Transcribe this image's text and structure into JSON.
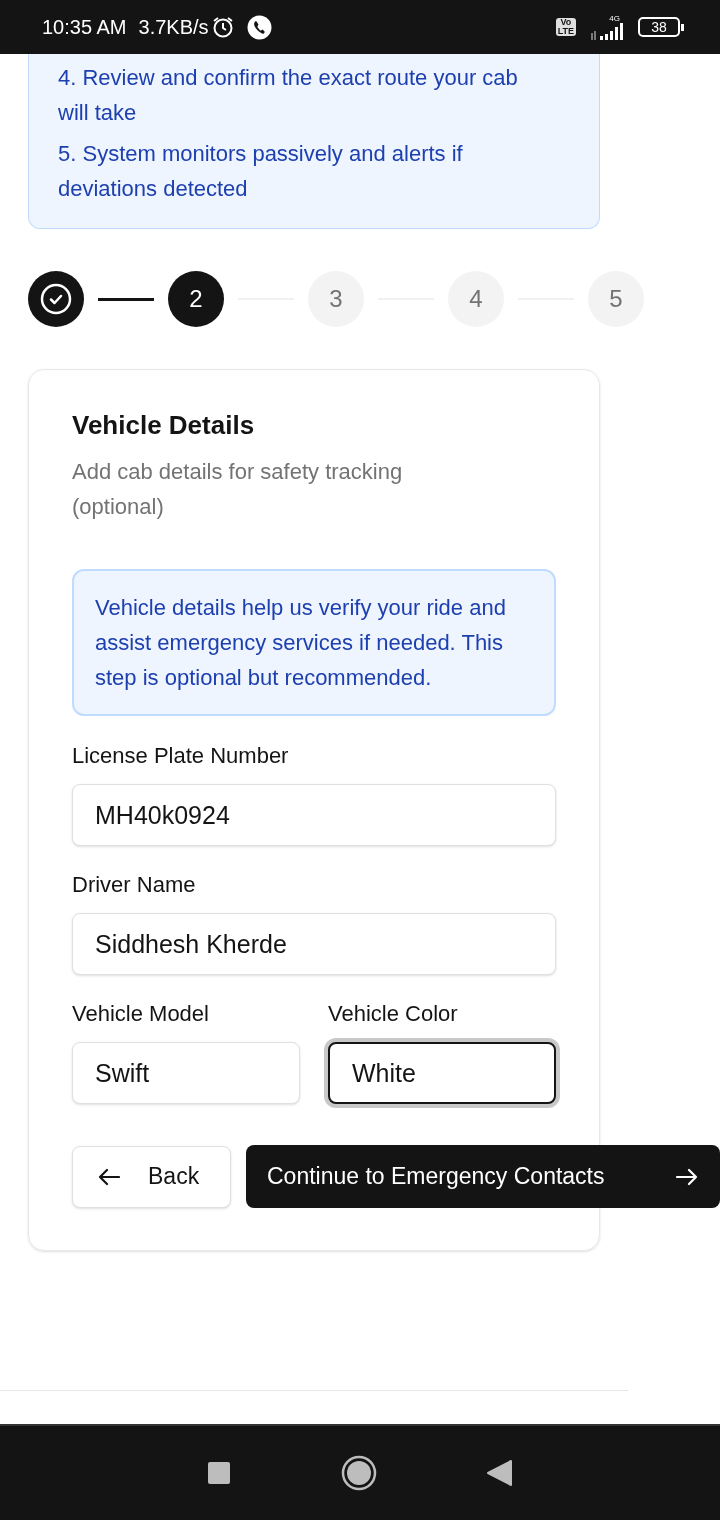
{
  "status_bar": {
    "time": "10:35 AM",
    "speed": "3.7KB/s",
    "volte": [
      "Vo",
      "LTE"
    ],
    "network": "4G",
    "battery": "38"
  },
  "info_steps": [
    "4. Review and confirm the exact route your cab will take",
    "5. System monitors passively and alerts if deviations detected"
  ],
  "stepper": [
    {
      "completed": true,
      "selected": false
    },
    {
      "label": "2",
      "completed": false,
      "selected": true
    },
    {
      "label": "3",
      "completed": false,
      "selected": false
    },
    {
      "label": "4",
      "completed": false,
      "selected": false
    },
    {
      "label": "5",
      "completed": false,
      "selected": false
    }
  ],
  "card": {
    "title": "Vehicle Details",
    "subtitle": "Add cab details for safety tracking (optional)",
    "notice": "Vehicle details help us verify your ride and assist emergency services if needed. This step is optional but recommended.",
    "fields": [
      {
        "label": "License Plate Number",
        "value": "MH40k0924",
        "focused": false,
        "kind": "wide"
      },
      {
        "label": "Driver Name",
        "value": "Siddhesh Kherde",
        "focused": false,
        "kind": "wide"
      },
      {
        "label": "Vehicle Model",
        "value": "Swift",
        "focused": false,
        "kind": "half"
      },
      {
        "label": "Vehicle Color",
        "value": "White",
        "focused": true,
        "kind": "half"
      }
    ],
    "back_button": "Back",
    "continue_button": "Continue to Emergency Contacts"
  }
}
